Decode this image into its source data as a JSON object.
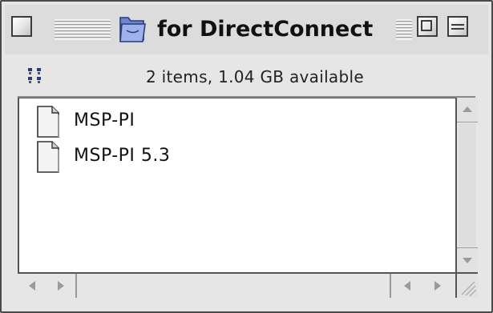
{
  "window": {
    "title": "for DirectConnect",
    "icon": "folder-icon"
  },
  "info_bar": {
    "status": "2 items, 1.04 GB available",
    "view_icon": "icon-view-icon"
  },
  "files": [
    {
      "name": "MSP-PI",
      "icon": "document-icon"
    },
    {
      "name": "MSP-PI 5.3",
      "icon": "document-icon"
    }
  ],
  "colors": {
    "window_bg": "#e6e6e6",
    "content_bg": "#ffffff",
    "folder_blue": "#8c9fdc",
    "frame": "#4a4a4a"
  }
}
